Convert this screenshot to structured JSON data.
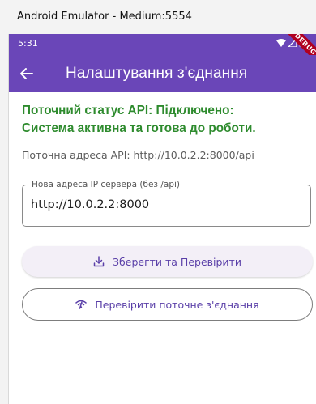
{
  "window": {
    "title": "Android Emulator - Medium:5554"
  },
  "status_bar": {
    "time": "5:31",
    "debug_label": "DEBUG"
  },
  "app_bar": {
    "title": "Налаштування з'єднання",
    "back_icon": "arrow-back-icon"
  },
  "main": {
    "status_line1": "Поточний статус API: Підключено:",
    "status_line2": "Система активна та готова до роботи.",
    "current_address": "Поточна адреса API: http://10.0.2.2:8000/api",
    "server_field": {
      "label": "Нова адреса IP сервера (без /api)",
      "value": "http://10.0.2.2:8000"
    },
    "save_button": {
      "label": "Зберегти та Перевірити",
      "icon": "download-icon"
    },
    "check_button": {
      "label": "Перевірити поточне з'єднання",
      "icon": "wifi-icon"
    }
  },
  "colors": {
    "app_bar": "#6a46b8",
    "status_ok": "#2e8b2e",
    "button_text": "#5a3fa8",
    "debug_ribbon": "#b00020"
  }
}
